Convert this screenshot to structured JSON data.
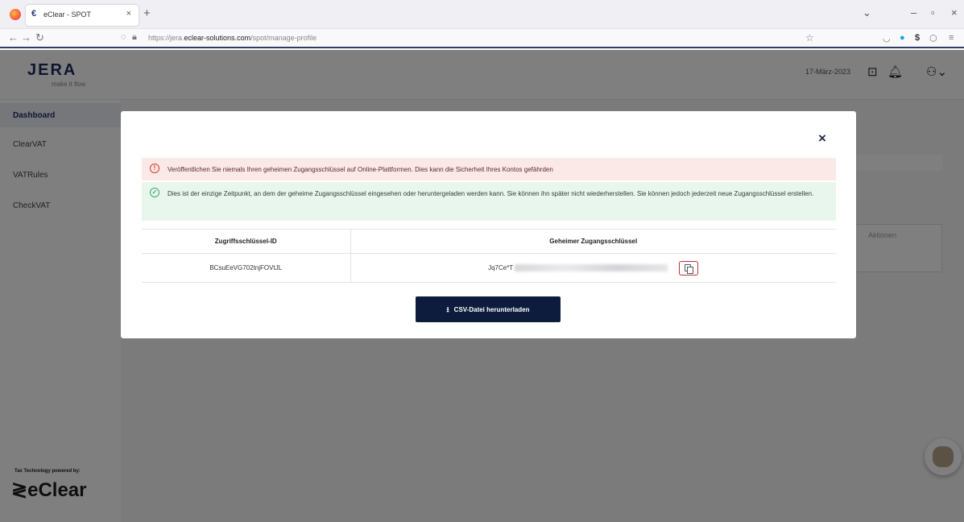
{
  "browser": {
    "tab_title": "eClear - SPOT",
    "tab_favicon": "€",
    "url_prefix": "https://jera.",
    "url_domain": "eclear-solutions.com",
    "url_path": "/spot/manage-profile"
  },
  "header": {
    "logo": "JERA",
    "logo_tagline": "make it flow",
    "date": "17-März-2023"
  },
  "sidebar": {
    "items": [
      {
        "label": "Dashboard"
      },
      {
        "label": "ClearVAT"
      },
      {
        "label": "VATRules"
      },
      {
        "label": "CheckVAT"
      }
    ],
    "powered_by": "Tax Technology powered by:",
    "brand": "eClear"
  },
  "background": {
    "actions_header": "Aktionen"
  },
  "modal": {
    "close_label": "×",
    "warning_text": "Veröffentlichen Sie niemals Ihren geheimen Zugangsschlüssel auf Online-Plattformen. Dies kann die Sicherheit Ihres Kontos gefährden",
    "info_text": "Dies ist der einzige Zeitpunkt, an dem der geheime Zugangsschlüssel eingesehen oder heruntergeladen werden kann. Sie können ihn später nicht wiederherstellen. Sie können jedoch jederzeit neue Zugangsschlüssel erstellen.",
    "table": {
      "col_key_id": "Zugriffsschlüssel-ID",
      "col_secret": "Geheimer Zugangsschlüssel",
      "key_id": "BCsuEeVG702tnjFOVtJL",
      "secret_prefix": "Jq7Ce*T"
    },
    "download_label": "CSV-Datei herunterladen"
  }
}
